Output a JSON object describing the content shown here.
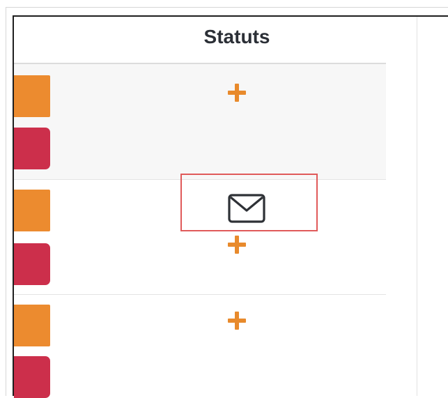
{
  "table": {
    "columns": [
      {
        "label": "Statuts"
      }
    ],
    "rows": [
      {
        "tags": [
          "orange",
          "red"
        ],
        "action": "add"
      },
      {
        "tags": [
          "orange",
          "red"
        ],
        "action": "add",
        "extra_action": "send-email"
      },
      {
        "tags": [
          "orange",
          "red"
        ],
        "action": "add"
      }
    ]
  },
  "colors": {
    "tag_orange": "#ec8b2f",
    "tag_red": "#cc2f4b",
    "plus_icon": "#e88a2c",
    "highlight": "#e05a5a",
    "header_text": "#2b2f36"
  },
  "icons": {
    "add": "plus-icon",
    "send_email": "envelope-icon"
  }
}
